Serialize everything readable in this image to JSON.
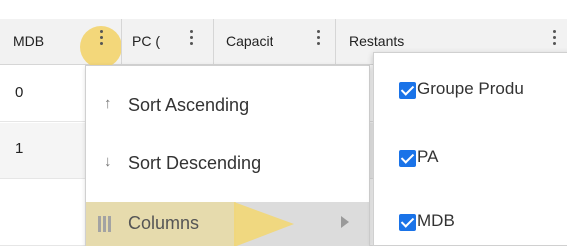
{
  "header": {
    "columns": [
      {
        "label": "MDB"
      },
      {
        "label": "PC ("
      },
      {
        "label": "Capacit"
      },
      {
        "label": "Restants"
      }
    ]
  },
  "rows": [
    {
      "value": "0"
    },
    {
      "value": "1"
    }
  ],
  "menu": {
    "sort_asc_icon": "↑",
    "sort_asc": "Sort Ascending",
    "sort_desc_icon": "↓",
    "sort_desc": "Sort Descending",
    "columns": "Columns"
  },
  "column_chooser": {
    "items": [
      {
        "label": "Groupe Produ",
        "checked": true
      },
      {
        "label": "PA",
        "checked": true
      },
      {
        "label": "MDB",
        "checked": true
      }
    ]
  },
  "colors": {
    "highlight": "#f3d77a",
    "checkbox": "#1a73e8",
    "header_bg": "#f2f2f2"
  }
}
